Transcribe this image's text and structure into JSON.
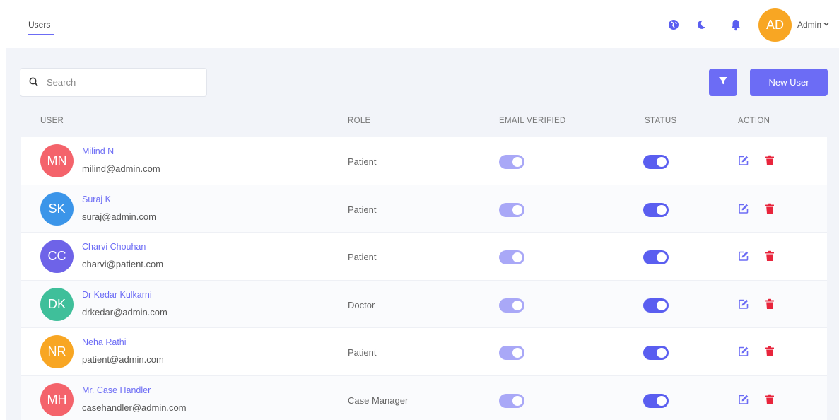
{
  "header": {
    "tab": "Users",
    "avatar_initials": "AD",
    "user_name": "Admin",
    "icons": [
      "globe-icon",
      "moon-icon",
      "bell-icon",
      "chevron-down-icon"
    ]
  },
  "toolbar": {
    "search_placeholder": "Search",
    "new_user_label": "New User"
  },
  "table": {
    "columns": [
      "USER",
      "ROLE",
      "EMAIL VERIFIED",
      "STATUS",
      "ACTION"
    ],
    "rows": [
      {
        "initials": "MN",
        "color": "#f4636b",
        "name": "Milind N",
        "email": "milind@admin.com",
        "role": "Patient",
        "email_verified": true,
        "status": true
      },
      {
        "initials": "SK",
        "color": "#3b95e9",
        "name": "Suraj K",
        "email": "suraj@admin.com",
        "role": "Patient",
        "email_verified": true,
        "status": true
      },
      {
        "initials": "CC",
        "color": "#6e63e8",
        "name": "Charvi Chouhan",
        "email": "charvi@patient.com",
        "role": "Patient",
        "email_verified": true,
        "status": true
      },
      {
        "initials": "DK",
        "color": "#3fbf9a",
        "name": "Dr Kedar Kulkarni",
        "email": "drkedar@admin.com",
        "role": "Doctor",
        "email_verified": true,
        "status": true
      },
      {
        "initials": "NR",
        "color": "#f8a623",
        "name": "Neha Rathi",
        "email": "patient@admin.com",
        "role": "Patient",
        "email_verified": true,
        "status": true
      },
      {
        "initials": "MH",
        "color": "#f4636b",
        "name": "Mr. Case Handler",
        "email": "casehandler@admin.com",
        "role": "Case Manager",
        "email_verified": true,
        "status": true
      }
    ]
  },
  "colors": {
    "accent": "#6c6cf5",
    "toggle_email": "#a9a8f7",
    "toggle_status": "#5a5ef0",
    "delete": "#e8253c",
    "header_avatar": "#f8a623"
  }
}
